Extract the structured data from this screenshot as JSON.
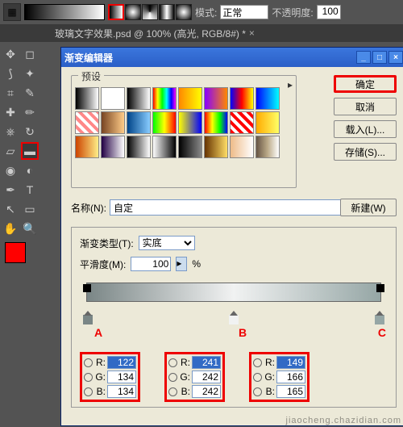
{
  "top": {
    "mode_label": "模式:",
    "mode_value": "正常",
    "opacity_label": "不透明度:",
    "opacity_value": "100"
  },
  "doc": {
    "title": "玻璃文字效果.psd @ 100% (高光, RGB/8#) *",
    "close": "×"
  },
  "dialog": {
    "title": "渐变编辑器",
    "presets_label": "预设",
    "ok": "确定",
    "cancel": "取消",
    "load": "载入(L)...",
    "save": "存储(S)...",
    "name_label": "名称(N):",
    "name_value": "自定",
    "new_btn": "新建(W)",
    "type_label": "渐变类型(T):",
    "type_value": "实底",
    "smooth_label": "平滑度(M):",
    "smooth_value": "100",
    "percent": "%"
  },
  "stops": {
    "a": {
      "label": "A",
      "r": "122",
      "g": "134",
      "b": "134"
    },
    "b": {
      "label": "B",
      "r": "241",
      "g": "242",
      "b": "242"
    },
    "c": {
      "label": "C",
      "r": "149",
      "g": "166",
      "b": "165"
    }
  },
  "rgb_labels": {
    "r": "R:",
    "g": "G:",
    "b": "B:"
  },
  "presets": [
    "linear-gradient(90deg,#000,#fff)",
    "#fff",
    "linear-gradient(90deg,#000,#fff)",
    "linear-gradient(90deg,#f00,#ff0,#0f0,#0ff,#00f,#f0f)",
    "linear-gradient(90deg,#f80,#ff0)",
    "linear-gradient(90deg,#80f,#f80)",
    "linear-gradient(90deg,#00f,#f00,#ff0)",
    "linear-gradient(90deg,#00f,#0ff)",
    "repeating-linear-gradient(45deg,#fff 0 4px,#f88 4px 8px)",
    "linear-gradient(90deg,#742,#fc8)",
    "linear-gradient(90deg,#048,#8cf)",
    "linear-gradient(90deg,#0f0,#ff0,#f00)",
    "linear-gradient(90deg,#ff0,#00f)",
    "linear-gradient(90deg,#f00,#ff0,#0f0,#00f)",
    "repeating-linear-gradient(45deg,#f00 0 4px,#fff 4px 8px)",
    "linear-gradient(90deg,#fa0,#ff6)",
    "linear-gradient(90deg,#c40,#fe8)",
    "linear-gradient(90deg,#204,#fff)",
    "linear-gradient(90deg,#000,#fff)",
    "linear-gradient(90deg,#fff,#000)",
    "linear-gradient(90deg,#000,#888)",
    "linear-gradient(90deg,#630,#fd6)",
    "linear-gradient(90deg,#eb8,#fff)",
    "linear-gradient(90deg,#654,#ba8,#fff)"
  ],
  "watermark": "jiaocheng.chazidian.com"
}
